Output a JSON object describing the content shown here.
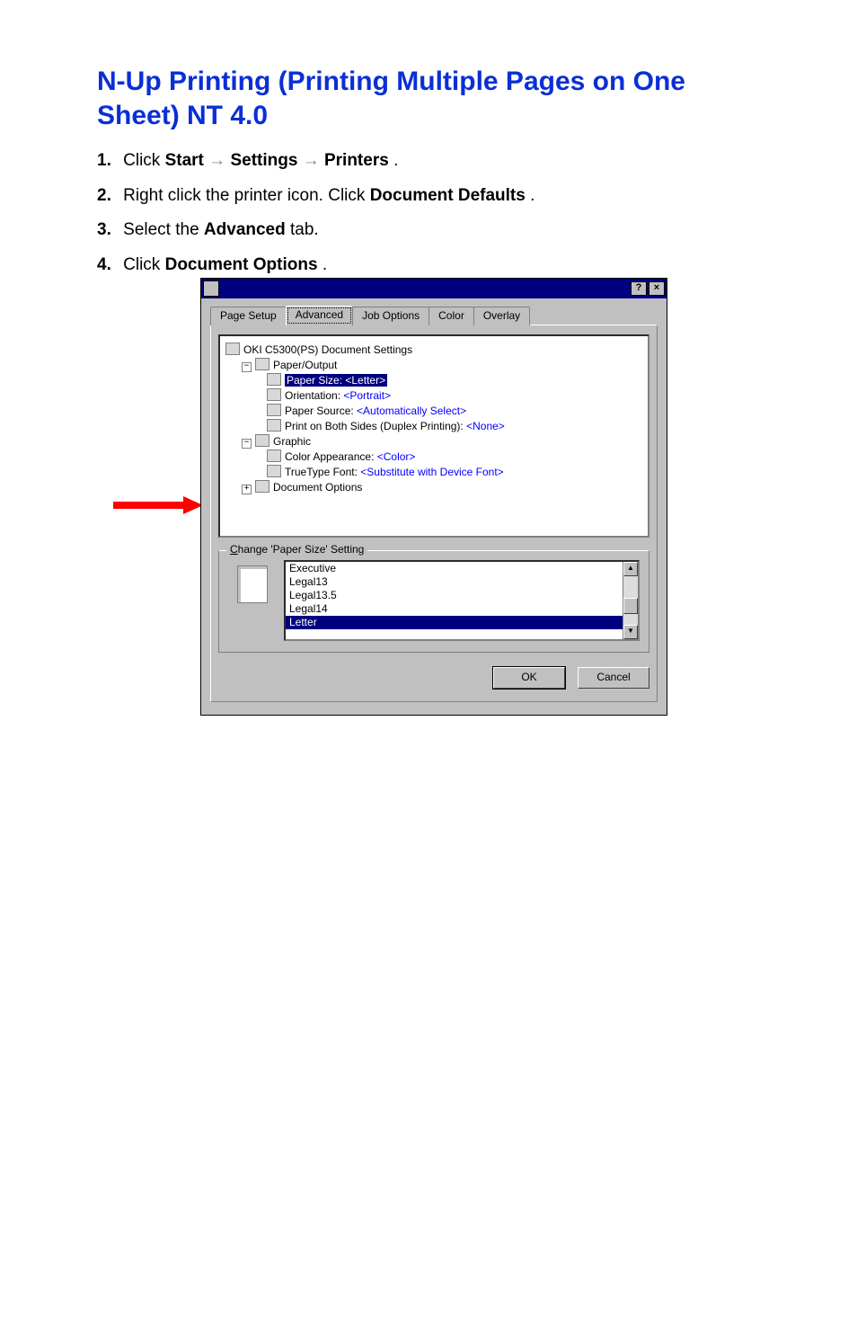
{
  "page": {
    "title": "N-Up Printing (Printing Multiple Pages on One Sheet) NT 4.0",
    "steps": {
      "s1": {
        "num": "1.",
        "a": "Click ",
        "b": "Start",
        "c": " → ",
        "d": "Settings",
        "e": " → ",
        "f": "Printers",
        "g": "."
      },
      "s2": {
        "num": "2.",
        "a": "Right click the printer icon. Click ",
        "b": "Document Defaults",
        "c": "."
      },
      "s3": {
        "num": "3.",
        "a": "Select the ",
        "b": "Advanced",
        "c": " tab."
      },
      "s4": {
        "num": "4.",
        "a": "Click ",
        "b": "Document Options",
        "c": "."
      }
    }
  },
  "dialog": {
    "tabs": {
      "page_setup": "Page Setup",
      "advanced": "Advanced",
      "job_options": "Job Options",
      "color": "Color",
      "overlay": "Overlay"
    },
    "tree": {
      "root": "OKI C5300(PS) Document Settings",
      "paper_output": "Paper/Output",
      "paper_size_label": "Paper Size: ",
      "paper_size_value": "<Letter>",
      "orientation_label": "Orientation: ",
      "orientation_value": "<Portrait>",
      "paper_source_label": "Paper Source: ",
      "paper_source_value": "<Automatically Select>",
      "duplex_label": "Print on Both Sides (Duplex Printing): ",
      "duplex_value": "<None>",
      "graphic": "Graphic",
      "color_app_label": "Color Appearance: ",
      "color_app_value": "<Color>",
      "ttf_label": "TrueType Font: ",
      "ttf_value": "<Substitute with Device Font>",
      "doc_options": "Document Options"
    },
    "group": {
      "title_pre": "C",
      "title_rest": "hange 'Paper Size' Setting",
      "items": {
        "executive": "Executive",
        "legal13": "Legal13",
        "legal135": "Legal13.5",
        "legal14": "Legal14",
        "letter": "Letter"
      }
    },
    "buttons": {
      "ok": "OK",
      "cancel": "Cancel",
      "help": "?",
      "close": "×"
    }
  }
}
